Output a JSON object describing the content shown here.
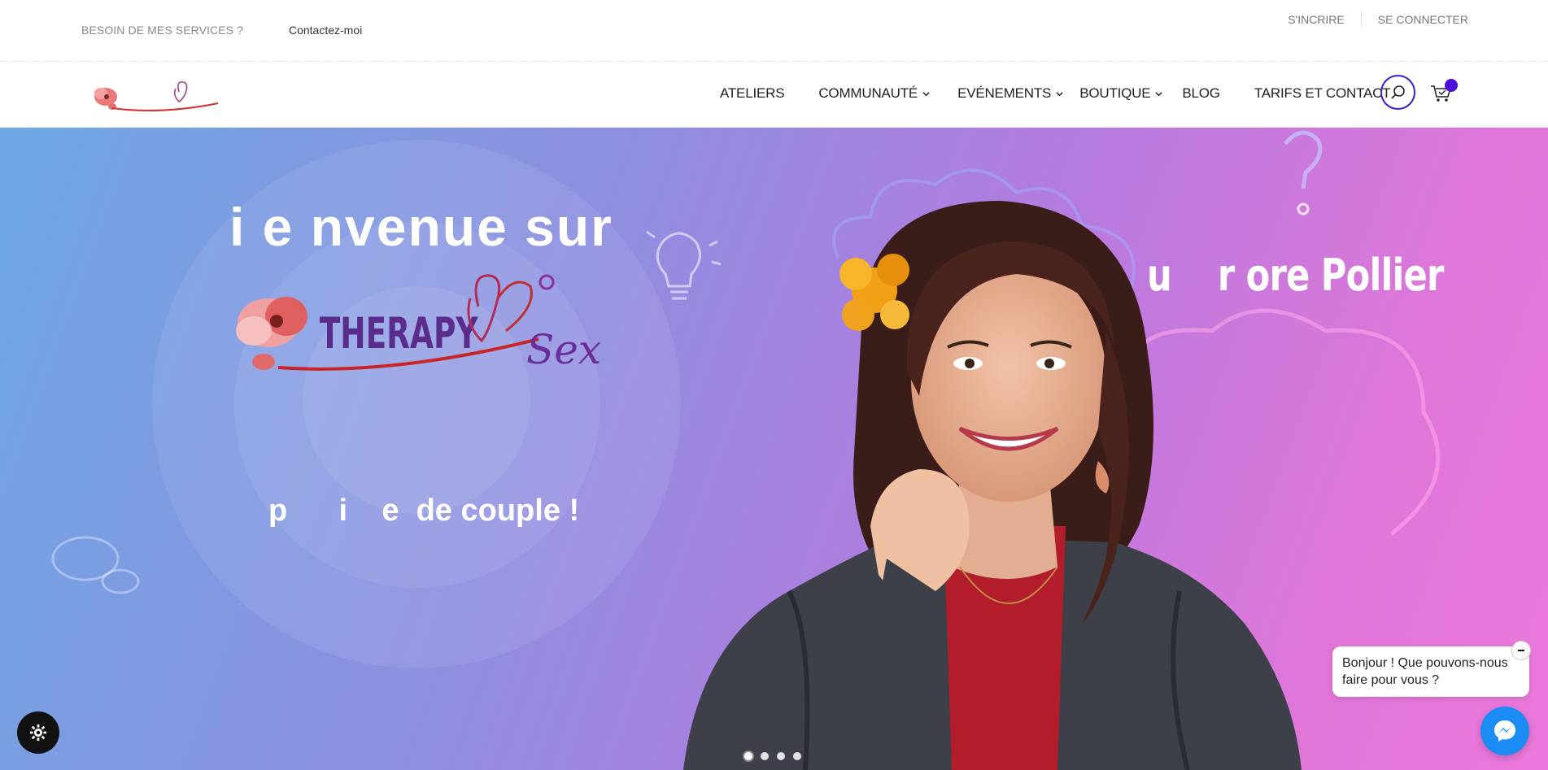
{
  "topbar": {
    "services_label": "BESOIN DE MES SERVICES ?",
    "contact_label": "Contactez-moi",
    "register_label": "S'INCRIRE",
    "login_label": "SE CONNECTER"
  },
  "header": {
    "logo_alt": "Therapy Sex logo",
    "nav": [
      {
        "label": "ATELIERS",
        "has_dropdown": false
      },
      {
        "label": "COMMUNAUTÉ",
        "has_dropdown": true
      },
      {
        "label": "EVÉNEMENTS",
        "has_dropdown": true
      },
      {
        "label": "BOUTIQUE",
        "has_dropdown": true
      },
      {
        "label": "BLOG",
        "has_dropdown": false
      },
      {
        "label": "TARIFS ET CONTACT",
        "has_dropdown": false
      }
    ],
    "search_icon": "search-icon",
    "cart_icon": "cart-icon",
    "accent_color": "#3d1fd0"
  },
  "hero": {
    "title": "i  e nvenue sur",
    "logo_text": "THERAPY",
    "logo_script": "Sex",
    "subtitle": "p      i    e  de couple !",
    "name": "u    r ore Pollier",
    "slides": 4,
    "active_slide": 0
  },
  "widgets": {
    "cookie_icon": "gear-icon",
    "chat_message": "Bonjour ! Que pouvons-nous faire pour vous ?",
    "messenger_icon": "messenger-icon",
    "messenger_color": "#1c8cf5"
  }
}
